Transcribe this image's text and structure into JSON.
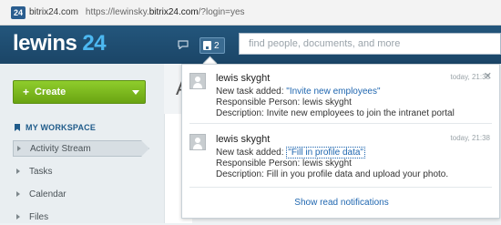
{
  "browser": {
    "site_chip_icon": "24",
    "site_chip_label": "bitrix24.com",
    "url_prefix": "https://lewinsky.",
    "url_domain": "bitrix24.com",
    "url_suffix": "/?login=yes"
  },
  "header": {
    "logo_text": "lewins",
    "logo_num": "24",
    "notif_count": "2",
    "search_placeholder": "find people, documents, and more"
  },
  "sidebar": {
    "create_label": "Create",
    "workspace_title": "MY WORKSPACE",
    "items": [
      {
        "label": "Activity Stream"
      },
      {
        "label": "Tasks"
      },
      {
        "label": "Calendar"
      },
      {
        "label": "Files"
      }
    ]
  },
  "main": {
    "title_fragment": "A"
  },
  "notifications": {
    "items": [
      {
        "author": "lewis skyght",
        "time": "today, 21:38",
        "prefix": "New task added: ",
        "task_link": "\"Invite new employees\"",
        "responsible": "Responsible Person: lewis skyght",
        "description": "Description: Invite new employees to join the intranet portal"
      },
      {
        "author": "lewis skyght",
        "time": "today, 21:38",
        "prefix": "New task added: ",
        "task_link": "\"Fill in profile data\"",
        "responsible": "Responsible Person: lewis skyght",
        "description": "Description: Fill in you profile data and upload your photo."
      }
    ],
    "show_read_label": "Show read notifications"
  }
}
